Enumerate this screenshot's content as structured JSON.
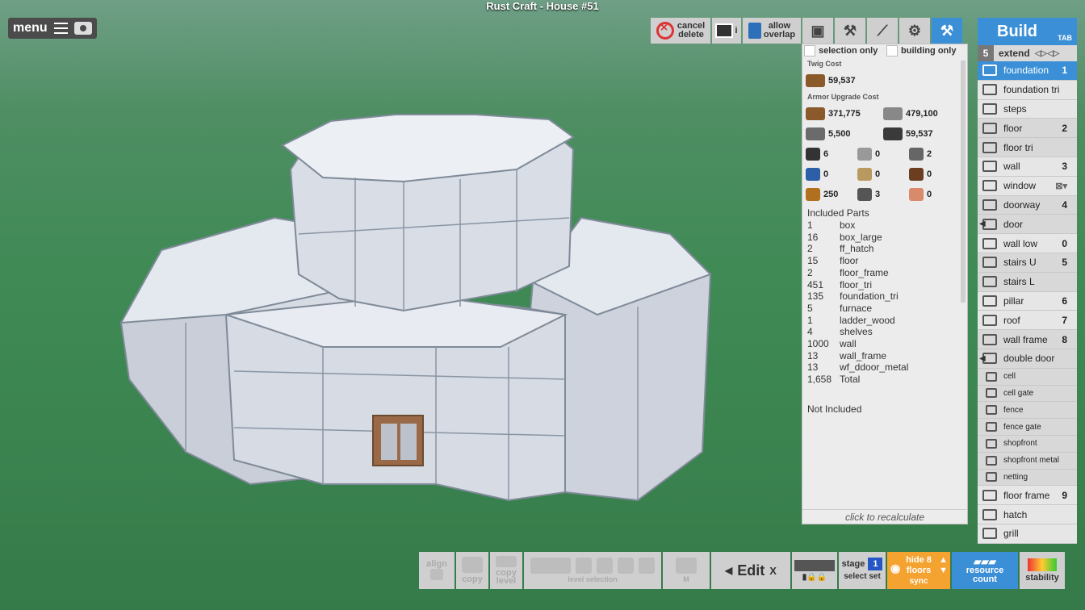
{
  "title": "Rust Craft - House #51",
  "menu": {
    "label": "menu"
  },
  "toolbar": {
    "cancel_label": [
      "cancel",
      "delete"
    ],
    "allow_label": [
      "allow",
      "overlap"
    ],
    "info": "i"
  },
  "cost_panel": {
    "selection_only": "selection only",
    "building_only": "building only",
    "twig_title": "Twig Cost",
    "twig_value": "59,537",
    "armor_title": "Armor Upgrade Cost",
    "armor": [
      {
        "value": "371,775",
        "color": "#8b5a2b"
      },
      {
        "value": "479,100",
        "color": "#888888"
      },
      {
        "value": "5,500",
        "color": "#6b6b6b"
      },
      {
        "value": "59,537",
        "color": "#3a3a3a"
      }
    ],
    "items": [
      [
        "6",
        "0",
        "2"
      ],
      [
        "0",
        "0",
        "0"
      ],
      [
        "250",
        "3",
        "0"
      ]
    ],
    "parts_title": "Included Parts",
    "parts": [
      {
        "n": "1",
        "name": "box"
      },
      {
        "n": "16",
        "name": "box_large"
      },
      {
        "n": "2",
        "name": "ff_hatch"
      },
      {
        "n": "15",
        "name": "floor"
      },
      {
        "n": "2",
        "name": "floor_frame"
      },
      {
        "n": "451",
        "name": "floor_tri"
      },
      {
        "n": "135",
        "name": "foundation_tri"
      },
      {
        "n": "5",
        "name": "furnace"
      },
      {
        "n": "1",
        "name": "ladder_wood"
      },
      {
        "n": "4",
        "name": "shelves"
      },
      {
        "n": "1000",
        "name": "wall"
      },
      {
        "n": "13",
        "name": "wall_frame"
      },
      {
        "n": "13",
        "name": "wf_ddoor_metal"
      },
      {
        "n": "1,658",
        "name": "Total"
      }
    ],
    "not_included": "Not Included",
    "recalc": "click to recalculate"
  },
  "build_panel": {
    "title": "Build",
    "tab_hint": "TAB",
    "extend_num": "5",
    "extend_label": "extend",
    "items": [
      {
        "label": "foundation",
        "key": "1",
        "active": true
      },
      {
        "label": "foundation tri",
        "key": ""
      },
      {
        "label": "steps",
        "key": ""
      },
      {
        "label": "floor",
        "key": "2"
      },
      {
        "label": "floor tri",
        "key": ""
      },
      {
        "label": "wall",
        "key": "3"
      },
      {
        "label": "window",
        "key": ""
      },
      {
        "label": "doorway",
        "key": "4"
      },
      {
        "label": "door",
        "key": ""
      },
      {
        "label": "wall low",
        "key": "0"
      },
      {
        "label": "stairs U",
        "key": "5"
      },
      {
        "label": "stairs L",
        "key": ""
      },
      {
        "label": "pillar",
        "key": "6"
      },
      {
        "label": "roof",
        "key": "7"
      },
      {
        "label": "wall frame",
        "key": "8"
      },
      {
        "label": "double door",
        "key": ""
      },
      {
        "label": "cell",
        "key": ""
      },
      {
        "label": "cell gate",
        "key": ""
      },
      {
        "label": "fence",
        "key": ""
      },
      {
        "label": "fence gate",
        "key": ""
      },
      {
        "label": "shopfront",
        "key": ""
      },
      {
        "label": "shopfront metal",
        "key": ""
      },
      {
        "label": "netting",
        "key": ""
      },
      {
        "label": "floor frame",
        "key": "9"
      },
      {
        "label": "hatch",
        "key": ""
      },
      {
        "label": "grill",
        "key": ""
      }
    ]
  },
  "bottom_bar": {
    "align": "align",
    "copy": "copy",
    "copy_level": [
      "copy",
      "level"
    ],
    "level_selection": "level selection",
    "m": "M",
    "edit": "Edit",
    "x": "X",
    "stage": "stage",
    "stage_num": "1",
    "select": "select",
    "set": "set",
    "hide": "hide",
    "floors": "floors",
    "hide_num": "8",
    "sync": "sync",
    "resource": [
      "resource",
      "count"
    ],
    "stability": "stability"
  }
}
